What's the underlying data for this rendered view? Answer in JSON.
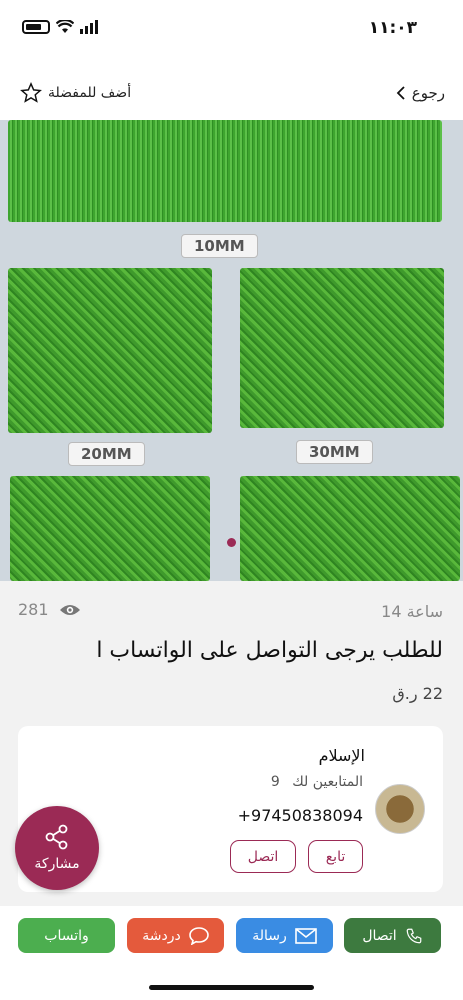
{
  "status_bar": {
    "time": "١١:٠٣"
  },
  "nav": {
    "back_label": "رجوع",
    "favorite_label": "أضف للمفضلة"
  },
  "gallery": {
    "sizes": [
      "10MM",
      "20MM",
      "30MM"
    ]
  },
  "listing": {
    "time_ago": "14 ساعة",
    "views": "281",
    "title": "للطلب يرجى التواصل على الواتساب ا",
    "price": "22 ر.ق"
  },
  "seller": {
    "name": "الإسلام",
    "followers_label": "المتابعين لك",
    "followers_count": "9",
    "phone": "+97450838094",
    "follow_label": "تابع",
    "call_label": "اتصل"
  },
  "share_label": "مشاركة",
  "actions": {
    "call": "اتصال",
    "message": "رسالة",
    "chat": "دردشة",
    "whatsapp": "واتساب"
  },
  "colors": {
    "accent": "#9b2a55",
    "call": "#3d7a3f",
    "message": "#3a8ce3",
    "chat": "#e45a3c",
    "whatsapp": "#4cae4f"
  }
}
